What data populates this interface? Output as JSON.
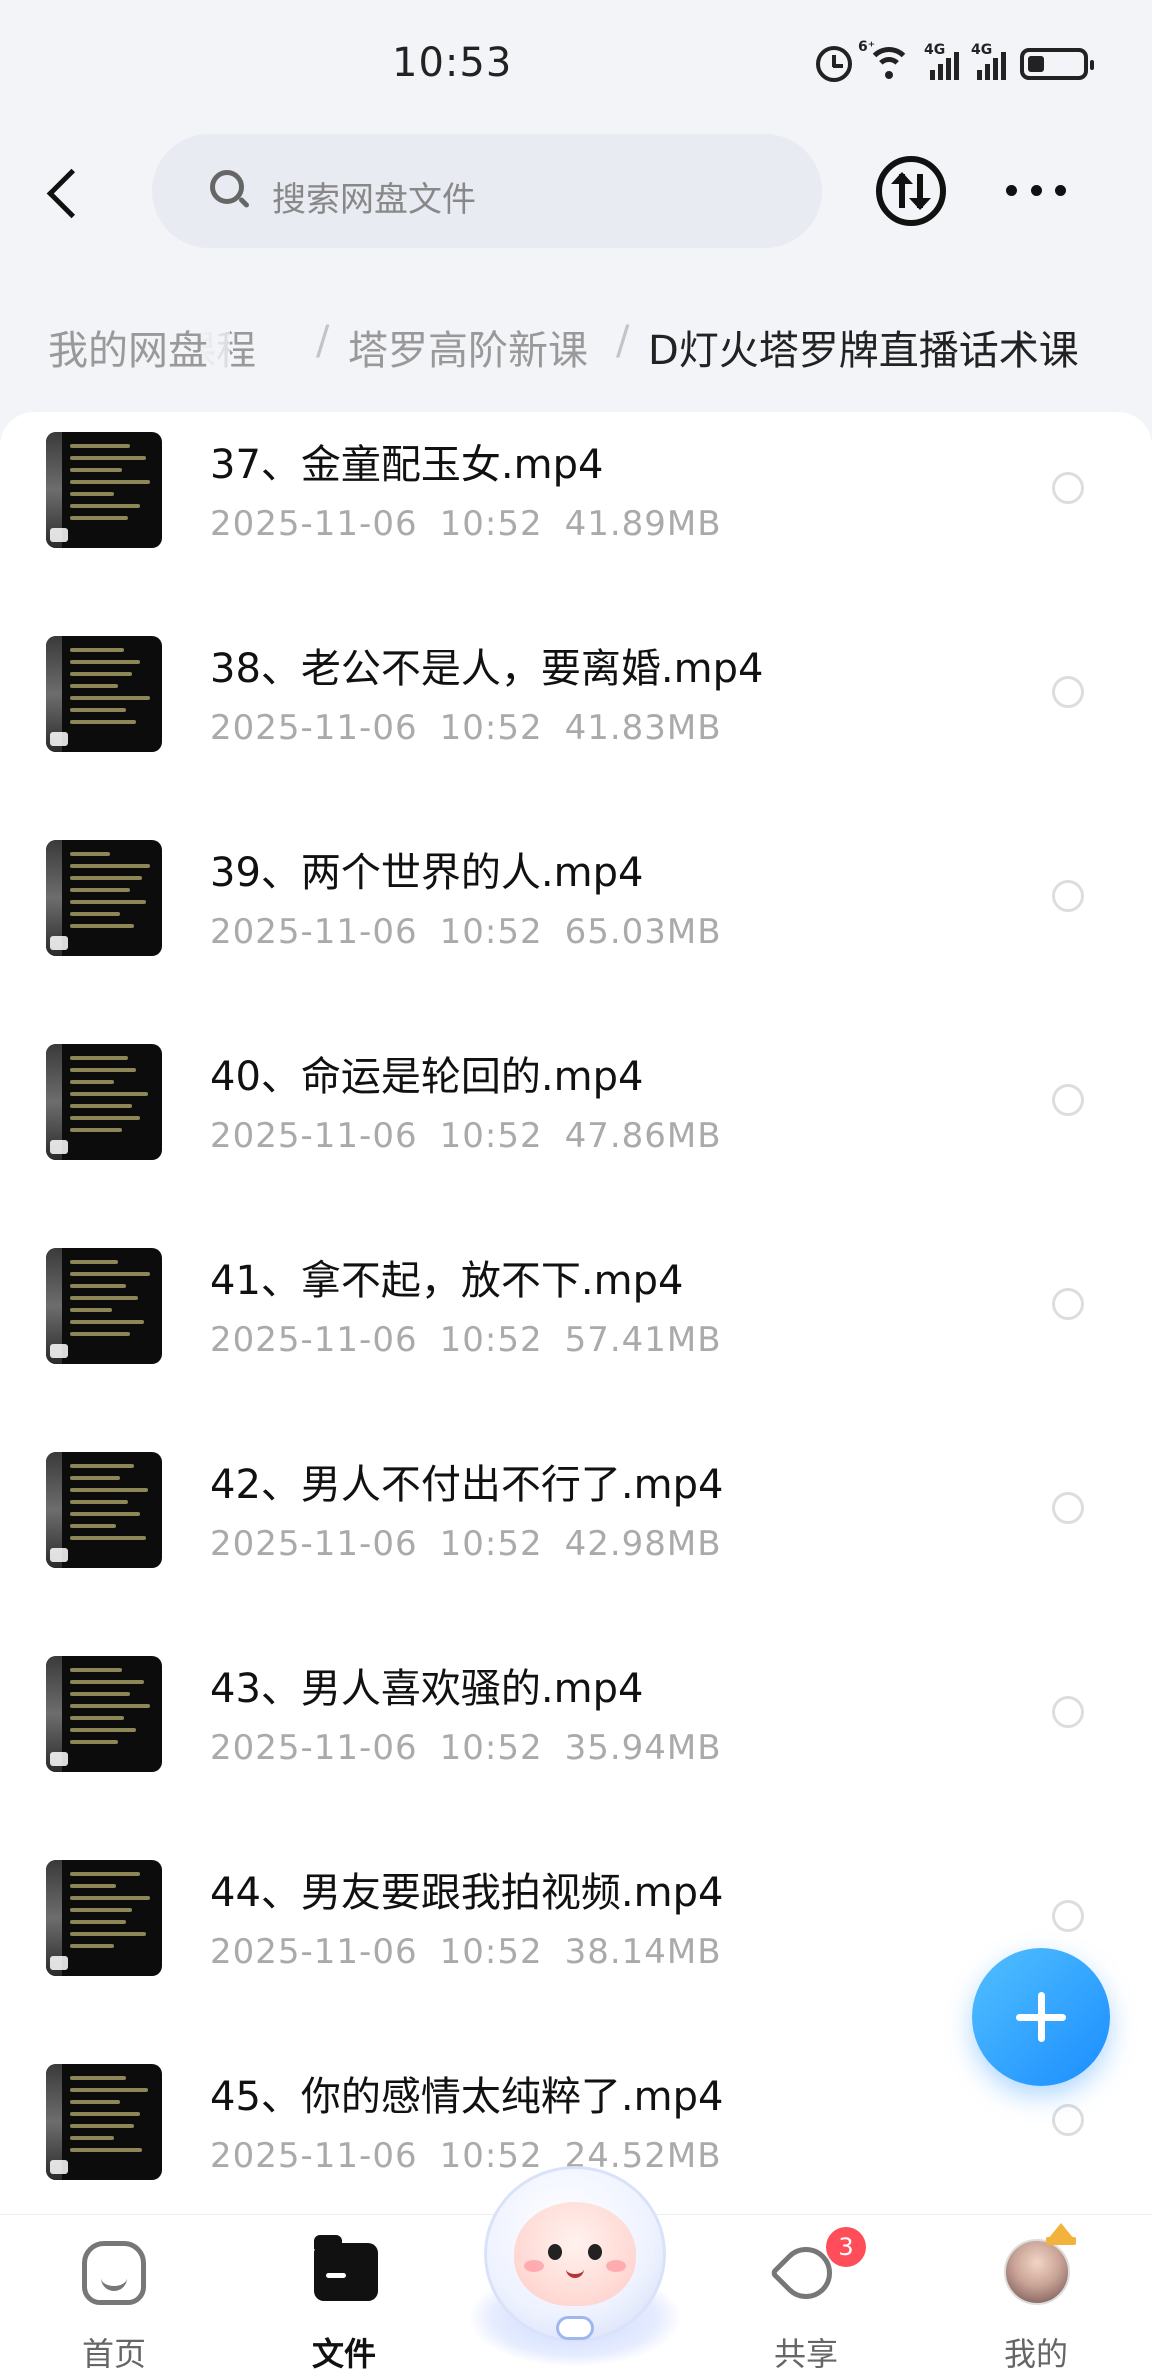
{
  "status_bar": {
    "time": "10:53",
    "icons": [
      "alarm-icon",
      "wifi-icon",
      "signal-4g-icon",
      "signal-4g-icon",
      "battery-icon"
    ],
    "wifi_badge": "6⁺",
    "sim1_label": "4G",
    "sim2_label": "4G"
  },
  "header": {
    "search_placeholder": "搜索网盘文件"
  },
  "breadcrumb": {
    "root": "我的网盘",
    "partial": "课程",
    "level2": "塔罗高阶新课",
    "current": "D灯火塔罗牌直播话术课",
    "separator": "/"
  },
  "files": [
    {
      "name": "37、金童配玉女.mp4",
      "date": "2025-11-06",
      "time": "10:52",
      "size": "41.89MB"
    },
    {
      "name": "38、老公不是人，要离婚.mp4",
      "date": "2025-11-06",
      "time": "10:52",
      "size": "41.83MB"
    },
    {
      "name": "39、两个世界的人.mp4",
      "date": "2025-11-06",
      "time": "10:52",
      "size": "65.03MB"
    },
    {
      "name": "40、命运是轮回的.mp4",
      "date": "2025-11-06",
      "time": "10:52",
      "size": "47.86MB"
    },
    {
      "name": "41、拿不起，放不下.mp4",
      "date": "2025-11-06",
      "time": "10:52",
      "size": "57.41MB"
    },
    {
      "name": "42、男人不付出不行了.mp4",
      "date": "2025-11-06",
      "time": "10:52",
      "size": "42.98MB"
    },
    {
      "name": "43、男人喜欢骚的.mp4",
      "date": "2025-11-06",
      "time": "10:52",
      "size": "35.94MB"
    },
    {
      "name": "44、男友要跟我拍视频.mp4",
      "date": "2025-11-06",
      "time": "10:52",
      "size": "38.14MB"
    },
    {
      "name": "45、你的感情太纯粹了.mp4",
      "date": "2025-11-06",
      "time": "10:52",
      "size": "24.52MB"
    }
  ],
  "bottom_nav": {
    "home": "首页",
    "files": "文件",
    "share": "共享",
    "share_badge": "3",
    "me": "我的",
    "active": "files"
  },
  "colors": {
    "accent": "#1a8dff",
    "badge": "#ff4d5a",
    "meta_text": "#aaaaaa"
  }
}
